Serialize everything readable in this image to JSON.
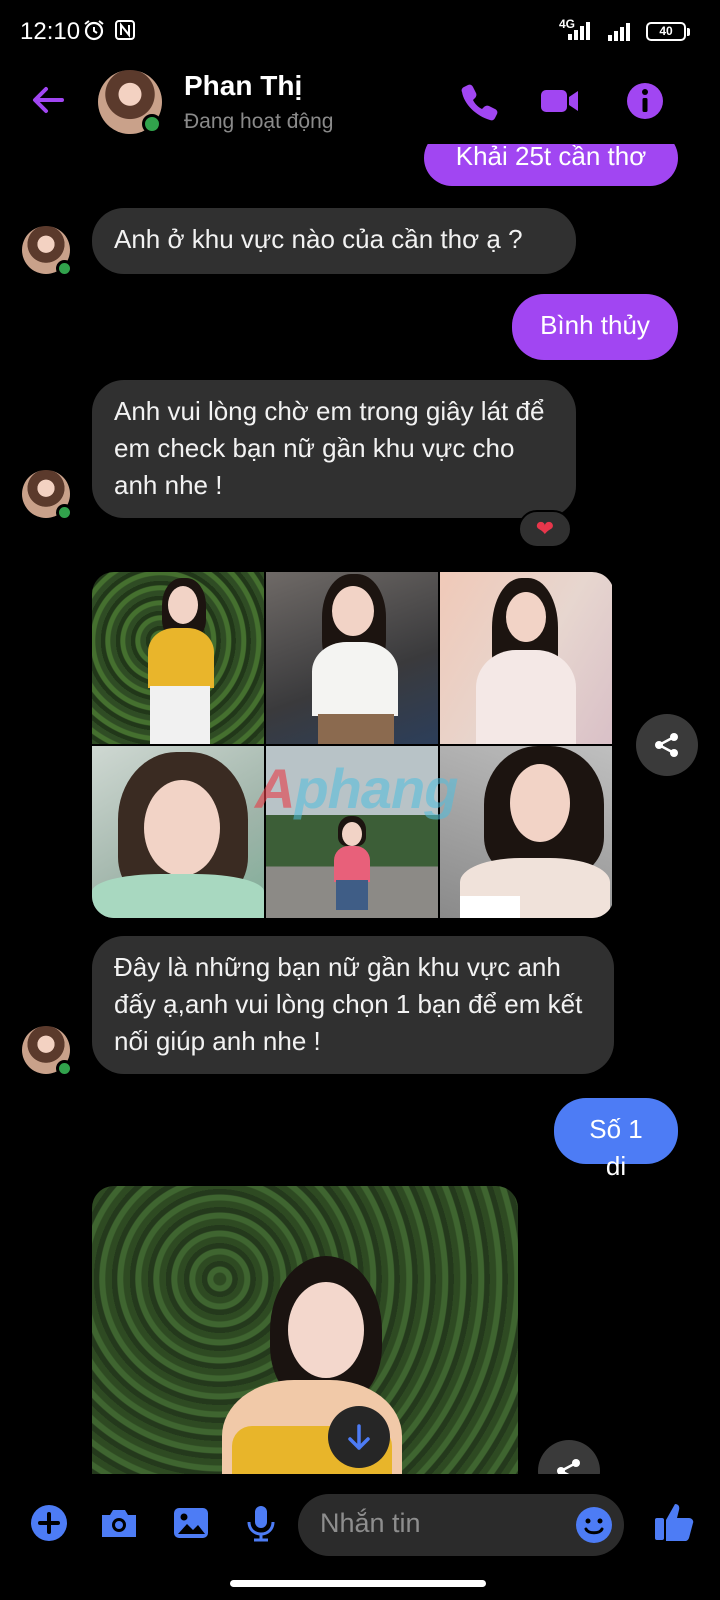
{
  "status_bar": {
    "time": "12:10",
    "network": "4G",
    "battery": "40"
  },
  "header": {
    "contact_name": "Phan Thị",
    "presence": "Đang hoạt động",
    "icons": [
      "back-arrow-icon",
      "phone-icon",
      "video-icon",
      "info-icon"
    ]
  },
  "messages": [
    {
      "from": "me",
      "text": "Khải 25t cần thơ"
    },
    {
      "from": "them",
      "text": "Anh ở khu vực nào của cần thơ ạ ?"
    },
    {
      "from": "me",
      "text": "Bình thủy"
    },
    {
      "from": "them",
      "text": "Anh vui lòng chờ em trong giây lát để em check bạn nữ gần khu vực cho anh nhe !",
      "reaction": "❤"
    },
    {
      "from": "them",
      "type": "photo-grid",
      "count": 6,
      "watermark": "Aphang"
    },
    {
      "from": "them",
      "text": "Đây là những bạn nữ gần khu vực anh đấy ạ,anh vui lòng chọn 1 bạn để em kết nối giúp anh nhe !"
    },
    {
      "from": "me",
      "text": "Số 1 di"
    },
    {
      "from": "them",
      "type": "photo"
    }
  ],
  "composer": {
    "placeholder": "Nhắn tin",
    "icons": [
      "plus-icon",
      "camera-icon",
      "gallery-icon",
      "microphone-icon",
      "emoji-icon",
      "thumbs-up-icon"
    ]
  },
  "colors": {
    "accent": "#a146f2",
    "blue_bubble": "#4d7cf5",
    "incoming_bubble": "#303030",
    "online": "#31a24c"
  }
}
